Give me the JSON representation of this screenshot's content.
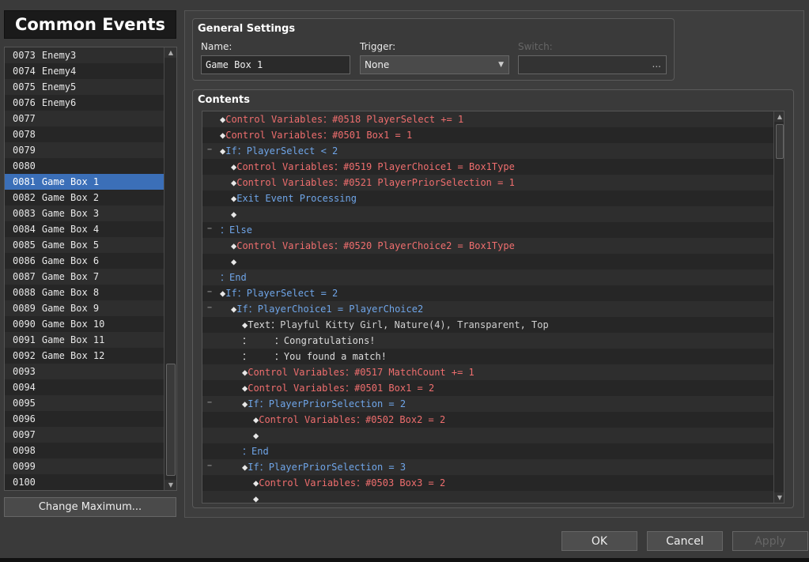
{
  "left": {
    "title": "Common Events",
    "events": [
      {
        "id": "0073",
        "name": "Enemy3"
      },
      {
        "id": "0074",
        "name": "Enemy4"
      },
      {
        "id": "0075",
        "name": "Enemy5"
      },
      {
        "id": "0076",
        "name": "Enemy6"
      },
      {
        "id": "0077",
        "name": ""
      },
      {
        "id": "0078",
        "name": ""
      },
      {
        "id": "0079",
        "name": ""
      },
      {
        "id": "0080",
        "name": ""
      },
      {
        "id": "0081",
        "name": "Game Box 1",
        "selected": true
      },
      {
        "id": "0082",
        "name": "Game Box 2"
      },
      {
        "id": "0083",
        "name": "Game Box 3"
      },
      {
        "id": "0084",
        "name": "Game Box 4"
      },
      {
        "id": "0085",
        "name": "Game Box 5"
      },
      {
        "id": "0086",
        "name": "Game Box 6"
      },
      {
        "id": "0087",
        "name": "Game Box 7"
      },
      {
        "id": "0088",
        "name": "Game Box 8"
      },
      {
        "id": "0089",
        "name": "Game Box 9"
      },
      {
        "id": "0090",
        "name": "Game Box 10"
      },
      {
        "id": "0091",
        "name": "Game Box 11"
      },
      {
        "id": "0092",
        "name": "Game Box 12"
      },
      {
        "id": "0093",
        "name": ""
      },
      {
        "id": "0094",
        "name": ""
      },
      {
        "id": "0095",
        "name": ""
      },
      {
        "id": "0096",
        "name": ""
      },
      {
        "id": "0097",
        "name": ""
      },
      {
        "id": "0098",
        "name": ""
      },
      {
        "id": "0099",
        "name": ""
      },
      {
        "id": "0100",
        "name": ""
      }
    ],
    "change_max_label": "Change Maximum..."
  },
  "general": {
    "title": "General Settings",
    "name_label": "Name:",
    "name_value": "Game Box 1",
    "trigger_label": "Trigger:",
    "trigger_value": "None",
    "switch_label": "Switch:",
    "switch_button": "..."
  },
  "contents": {
    "title": "Contents",
    "commands": [
      {
        "indent": 0,
        "collapse": false,
        "parts": [
          [
            "w",
            "◆"
          ],
          [
            "r",
            "Control Variables："
          ],
          [
            "r",
            "#0518 PlayerSelect += 1"
          ]
        ]
      },
      {
        "indent": 0,
        "collapse": false,
        "parts": [
          [
            "w",
            "◆"
          ],
          [
            "r",
            "Control Variables："
          ],
          [
            "r",
            "#0501 Box1 = 1"
          ]
        ]
      },
      {
        "indent": 0,
        "collapse": true,
        "parts": [
          [
            "w",
            "◆"
          ],
          [
            "b",
            "If："
          ],
          [
            "b",
            "PlayerSelect < 2"
          ]
        ]
      },
      {
        "indent": 1,
        "collapse": false,
        "parts": [
          [
            "w",
            "◆"
          ],
          [
            "r",
            "Control Variables："
          ],
          [
            "r",
            "#0519 PlayerChoice1 = Box1Type"
          ]
        ]
      },
      {
        "indent": 1,
        "collapse": false,
        "parts": [
          [
            "w",
            "◆"
          ],
          [
            "r",
            "Control Variables："
          ],
          [
            "r",
            "#0521 PlayerPriorSelection = 1"
          ]
        ]
      },
      {
        "indent": 1,
        "collapse": false,
        "parts": [
          [
            "w",
            "◆"
          ],
          [
            "b",
            "Exit Event Processing"
          ]
        ]
      },
      {
        "indent": 1,
        "collapse": false,
        "parts": [
          [
            "w",
            "◆"
          ]
        ]
      },
      {
        "indent": 0,
        "collapse": true,
        "parts": [
          [
            "b",
            "："
          ],
          [
            "b",
            "Else"
          ]
        ]
      },
      {
        "indent": 1,
        "collapse": false,
        "parts": [
          [
            "w",
            "◆"
          ],
          [
            "r",
            "Control Variables："
          ],
          [
            "r",
            "#0520 PlayerChoice2 = Box1Type"
          ]
        ]
      },
      {
        "indent": 1,
        "collapse": false,
        "parts": [
          [
            "w",
            "◆"
          ]
        ]
      },
      {
        "indent": 0,
        "collapse": false,
        "parts": [
          [
            "b",
            "："
          ],
          [
            "b",
            "End"
          ]
        ]
      },
      {
        "indent": 0,
        "collapse": true,
        "parts": [
          [
            "w",
            "◆"
          ],
          [
            "b",
            "If："
          ],
          [
            "b",
            "PlayerSelect = 2"
          ]
        ]
      },
      {
        "indent": 1,
        "collapse": true,
        "parts": [
          [
            "w",
            "◆"
          ],
          [
            "b",
            "If："
          ],
          [
            "b",
            "PlayerChoice1 = PlayerChoice2"
          ]
        ]
      },
      {
        "indent": 2,
        "collapse": false,
        "parts": [
          [
            "w",
            "◆"
          ],
          [
            "k",
            "Text："
          ],
          [
            "l",
            "Playful Kitty Girl, Nature(4), Transparent, Top"
          ]
        ]
      },
      {
        "indent": 2,
        "collapse": false,
        "parts": [
          [
            "w",
            "："
          ],
          [
            "w",
            "    ："
          ],
          [
            "k",
            "Congratulations!"
          ]
        ]
      },
      {
        "indent": 2,
        "collapse": false,
        "parts": [
          [
            "w",
            "："
          ],
          [
            "w",
            "    ："
          ],
          [
            "k",
            "You found a match!"
          ]
        ]
      },
      {
        "indent": 2,
        "collapse": false,
        "parts": [
          [
            "w",
            "◆"
          ],
          [
            "r",
            "Control Variables："
          ],
          [
            "r",
            "#0517 MatchCount += 1"
          ]
        ]
      },
      {
        "indent": 2,
        "collapse": false,
        "parts": [
          [
            "w",
            "◆"
          ],
          [
            "r",
            "Control Variables："
          ],
          [
            "r",
            "#0501 Box1 = 2"
          ]
        ]
      },
      {
        "indent": 2,
        "collapse": true,
        "parts": [
          [
            "w",
            "◆"
          ],
          [
            "b",
            "If："
          ],
          [
            "b",
            "PlayerPriorSelection = 2"
          ]
        ]
      },
      {
        "indent": 3,
        "collapse": false,
        "parts": [
          [
            "w",
            "◆"
          ],
          [
            "r",
            "Control Variables："
          ],
          [
            "r",
            "#0502 Box2 = 2"
          ]
        ]
      },
      {
        "indent": 3,
        "collapse": false,
        "parts": [
          [
            "w",
            "◆"
          ]
        ]
      },
      {
        "indent": 2,
        "collapse": false,
        "parts": [
          [
            "b",
            "："
          ],
          [
            "b",
            "End"
          ]
        ]
      },
      {
        "indent": 2,
        "collapse": true,
        "parts": [
          [
            "w",
            "◆"
          ],
          [
            "b",
            "If："
          ],
          [
            "b",
            "PlayerPriorSelection = 3"
          ]
        ]
      },
      {
        "indent": 3,
        "collapse": false,
        "parts": [
          [
            "w",
            "◆"
          ],
          [
            "r",
            "Control Variables："
          ],
          [
            "r",
            "#0503 Box3 = 2"
          ]
        ]
      },
      {
        "indent": 3,
        "collapse": false,
        "parts": [
          [
            "w",
            "◆"
          ]
        ]
      }
    ]
  },
  "buttons": {
    "ok": "OK",
    "cancel": "Cancel",
    "apply": "Apply"
  },
  "icons": {
    "scroll_up": "▲",
    "scroll_down": "▼",
    "dropdown": "▼",
    "collapse": "−"
  }
}
